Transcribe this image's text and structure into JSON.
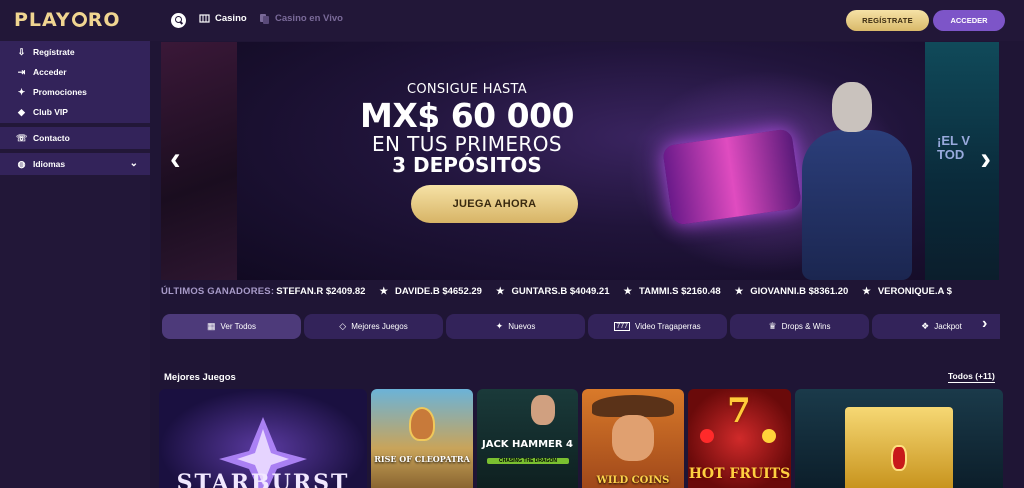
{
  "header": {
    "logo": "PLAY",
    "logo_end": "RO",
    "nav": [
      {
        "label": "Casino",
        "icon": "slots-icon"
      },
      {
        "label": "Casino en Vivo",
        "icon": "cards-icon"
      }
    ],
    "register_label": "REGÍSTRATE",
    "login_label": "ACCEDER"
  },
  "sidebar": {
    "group1": [
      {
        "label": "Regístrate",
        "icon": "user-add-icon"
      },
      {
        "label": "Acceder",
        "icon": "login-icon"
      },
      {
        "label": "Promociones",
        "icon": "gift-icon"
      },
      {
        "label": "Club VIP",
        "icon": "diamond-icon"
      }
    ],
    "contact": {
      "label": "Contacto",
      "icon": "phone-icon"
    },
    "languages": {
      "label": "Idiomas",
      "icon": "globe-icon"
    }
  },
  "banner": {
    "line1": "CONSIGUE HASTA",
    "amount": "MX$ 60 000",
    "line3": "EN TUS PRIMEROS",
    "line4": "3 DEPÓSITOS",
    "cta": "JUEGA AHORA",
    "side_text": "¡EL V\nTOD"
  },
  "ticker": {
    "label": "ÚLTIMOS GANADORES:",
    "winners": [
      "STEFAN.R $2409.82",
      "DAVIDE.B $4652.29",
      "GUNTARS.B $4049.21",
      "TAMMI.S $2160.48",
      "GIOVANNI.B $8361.20",
      "VERONIQUE.A $"
    ]
  },
  "tabs": [
    {
      "label": "Ver Todos",
      "icon": "grid-icon"
    },
    {
      "label": "Mejores Juegos",
      "icon": "diamond-icon"
    },
    {
      "label": "Nuevos",
      "icon": "sparkle-icon"
    },
    {
      "label": "Video Tragaperras",
      "icon": "slot-777-icon"
    },
    {
      "label": "Drops & Wins",
      "icon": "crown-icon"
    },
    {
      "label": "Jackpot",
      "icon": "jackpot-icon"
    }
  ],
  "section": {
    "title": "Mejores Juegos",
    "all_label": "Todos (+11)"
  },
  "games": [
    {
      "name": "STARBURST"
    },
    {
      "name": "RISE OF CLEOPATRA"
    },
    {
      "name": "JACK HAMMER 4",
      "subtitle": "CHASING THE DRAGON"
    },
    {
      "name": "WILD COINS"
    },
    {
      "name": "HOT FRUITS",
      "number": "7"
    },
    {
      "name": ""
    }
  ],
  "colors": {
    "background": "#1f1535",
    "sidebar": "#221738",
    "accent_gold": "#e8cc84",
    "accent_purple": "#7d55c8"
  }
}
